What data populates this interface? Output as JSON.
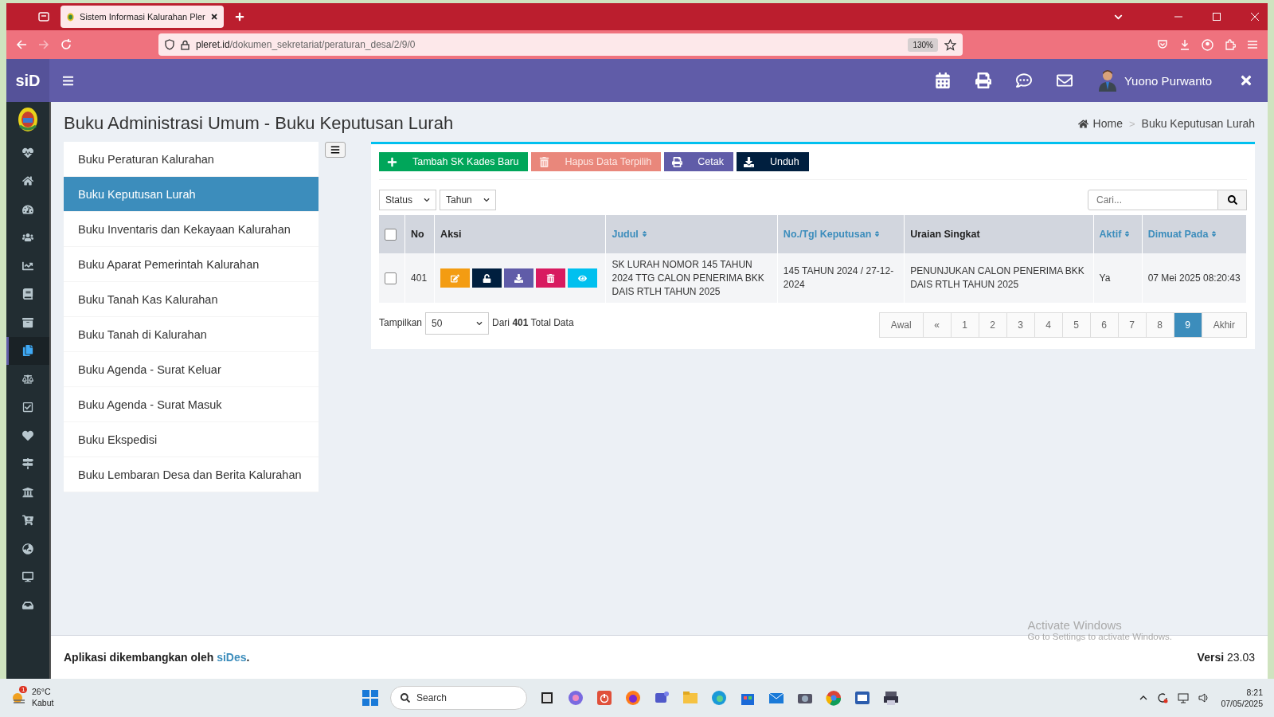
{
  "browser": {
    "tab_title": "Sistem Informasi Kalurahan Pler",
    "url_host": "pleret.id",
    "url_path": "/dokumen_sekretariat/peraturan_desa/2/9/0",
    "zoom": "130%"
  },
  "header": {
    "logo": "siD",
    "user_name": "Yuono Purwanto"
  },
  "sidebar": {
    "items": [
      {
        "selected": false
      },
      {
        "selected": false
      },
      {
        "selected": false
      },
      {
        "selected": false
      },
      {
        "selected": false
      },
      {
        "selected": false
      },
      {
        "selected": false
      },
      {
        "selected": true
      },
      {
        "selected": false
      },
      {
        "selected": false
      },
      {
        "selected": false
      },
      {
        "selected": false
      },
      {
        "selected": false
      },
      {
        "selected": false
      },
      {
        "selected": false
      },
      {
        "selected": false
      },
      {
        "selected": false
      }
    ]
  },
  "page": {
    "title": "Buku Administrasi Umum - Buku Keputusan Lurah",
    "breadcrumbs": [
      "Home",
      "Buku Keputusan Lurah"
    ],
    "breadcrumb_separator": ">"
  },
  "menu": {
    "items": [
      {
        "label": "Buku Peraturan Kalurahan",
        "selected": false
      },
      {
        "label": "Buku Keputusan Lurah",
        "selected": true
      },
      {
        "label": "Buku Inventaris dan Kekayaan Kalurahan",
        "selected": false
      },
      {
        "label": "Buku Aparat Pemerintah Kalurahan",
        "selected": false
      },
      {
        "label": "Buku Tanah Kas Kalurahan",
        "selected": false
      },
      {
        "label": "Buku Tanah di Kalurahan",
        "selected": false
      },
      {
        "label": "Buku Agenda - Surat Keluar",
        "selected": false
      },
      {
        "label": "Buku Agenda - Surat Masuk",
        "selected": false
      },
      {
        "label": "Buku Ekspedisi",
        "selected": false
      },
      {
        "label": "Buku Lembaran Desa dan Berita Kalurahan",
        "selected": false
      }
    ]
  },
  "toolbar": {
    "buttons": [
      {
        "label": "Tambah SK Kades Baru",
        "kind": "add",
        "color": "#00a65a",
        "disabled": false
      },
      {
        "label": "Hapus Data Terpilih",
        "kind": "delete",
        "color": "#e9877b",
        "disabled": true
      },
      {
        "label": "Cetak",
        "kind": "print",
        "color": "#605ca8",
        "disabled": false
      },
      {
        "label": "Unduh",
        "kind": "download",
        "color": "#001f3f",
        "disabled": false
      }
    ]
  },
  "filters": [
    {
      "value": "Status"
    },
    {
      "value": "Tahun"
    }
  ],
  "search": {
    "placeholder": "Cari..."
  },
  "table": {
    "all_checked": false,
    "columns": [
      {
        "label": "No",
        "sortable": false
      },
      {
        "label": "Aksi",
        "sortable": false
      },
      {
        "label": "Judul",
        "sortable": true
      },
      {
        "label": "No./Tgl Keputusan",
        "sortable": true
      },
      {
        "label": "Uraian Singkat",
        "sortable": false
      },
      {
        "label": "Aktif",
        "sortable": true
      },
      {
        "label": "Dimuat Pada",
        "sortable": true
      }
    ],
    "rows": [
      {
        "checked": false,
        "no": "401",
        "actions": [
          {
            "kind": "edit",
            "color": "#f39c12"
          },
          {
            "kind": "lock",
            "color": "#001f3f"
          },
          {
            "kind": "download",
            "color": "#605ca8"
          },
          {
            "kind": "delete",
            "color": "#d81b60"
          },
          {
            "kind": "view",
            "color": "#00c0ef"
          }
        ],
        "judul": "SK LURAH NOMOR 145 TAHUN 2024 TTG CALON PENERIMA BKK DAIS RTLH TAHUN 2025",
        "nomor": "145 TAHUN 2024 / 27-12-2024",
        "uraian": "PENUNJUKAN CALON PENERIMA BKK DAIS RTLH TAHUN 2025",
        "aktif": "Ya",
        "dimuat": "07 Mei 2025 08:20:43"
      }
    ]
  },
  "footer_table": {
    "show_label": "Tampilkan",
    "page_size": "50",
    "total": "Dari **401** Total Data"
  },
  "pagination": [
    {
      "label": "Awal",
      "selected": false
    },
    {
      "label": "«",
      "selected": false
    },
    {
      "label": "1",
      "selected": false
    },
    {
      "label": "2",
      "selected": false
    },
    {
      "label": "3",
      "selected": false
    },
    {
      "label": "4",
      "selected": false
    },
    {
      "label": "5",
      "selected": false
    },
    {
      "label": "6",
      "selected": false
    },
    {
      "label": "7",
      "selected": false
    },
    {
      "label": "8",
      "selected": false
    },
    {
      "label": "9",
      "selected": true
    },
    {
      "label": "Akhir",
      "selected": false
    }
  ],
  "footer": {
    "credit": "Aplikasi dikembangkan oleh",
    "credit_link": "siDes",
    "credit_end": ".",
    "version": "**Versi** 23.03"
  },
  "activation": {
    "title": "Activate Windows",
    "hint": "Go to Settings to activate Windows."
  },
  "taskbar": {
    "temperature": "26°C",
    "weather": "Kabut",
    "weather_badge": "1",
    "search": "Search",
    "time": "8:21",
    "date": "07/05/2025"
  }
}
